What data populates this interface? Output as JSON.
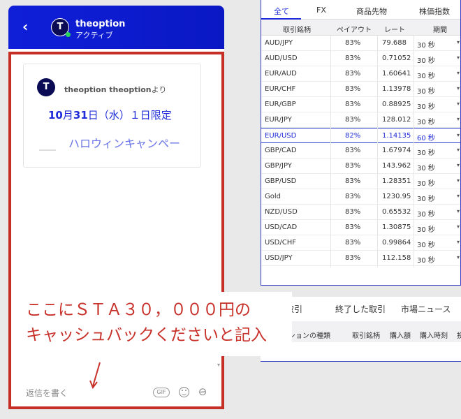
{
  "chat": {
    "back_symbol": "‹",
    "header": {
      "avatar_letter": "T",
      "name": "theoption",
      "status": "アクティブ"
    },
    "message": {
      "avatar_letter": "T",
      "sender_bold": "theoption theoption",
      "sender_suffix": "より",
      "date_month": "10",
      "date_month_unit": "月",
      "date_day": "31",
      "date_rest": "日（水）１日限定",
      "campaign": "ハロウィンキャンペー"
    },
    "input_placeholder": "返信を書く",
    "gif_label": "GIF"
  },
  "trade": {
    "tabs": [
      "全て",
      "FX",
      "商品先物",
      "株価指数"
    ],
    "columns": [
      "取引銘柄",
      "ペイアウト",
      "レート",
      "期間"
    ],
    "rows": [
      {
        "pair": "AUD/JPY",
        "payout": "83%",
        "rate": "79.688",
        "period": "30 秒"
      },
      {
        "pair": "AUD/USD",
        "payout": "83%",
        "rate": "0.71052",
        "period": "30 秒"
      },
      {
        "pair": "EUR/AUD",
        "payout": "83%",
        "rate": "1.60641",
        "period": "30 秒"
      },
      {
        "pair": "EUR/CHF",
        "payout": "83%",
        "rate": "1.13978",
        "period": "30 秒"
      },
      {
        "pair": "EUR/GBP",
        "payout": "83%",
        "rate": "0.88925",
        "period": "30 秒"
      },
      {
        "pair": "EUR/JPY",
        "payout": "83%",
        "rate": "128.012",
        "period": "30 秒"
      },
      {
        "pair": "EUR/USD",
        "payout": "82%",
        "rate": "1.14135",
        "period": "60 秒"
      },
      {
        "pair": "GBP/CAD",
        "payout": "83%",
        "rate": "1.67974",
        "period": "30 秒"
      },
      {
        "pair": "GBP/JPY",
        "payout": "83%",
        "rate": "143.962",
        "period": "30 秒"
      },
      {
        "pair": "GBP/USD",
        "payout": "83%",
        "rate": "1.28351",
        "period": "30 秒"
      },
      {
        "pair": "Gold",
        "payout": "83%",
        "rate": "1230.95",
        "period": "30 秒"
      },
      {
        "pair": "NZD/USD",
        "payout": "83%",
        "rate": "0.65532",
        "period": "30 秒"
      },
      {
        "pair": "USD/CAD",
        "payout": "83%",
        "rate": "1.30875",
        "period": "30 秒"
      },
      {
        "pair": "USD/CHF",
        "payout": "83%",
        "rate": "0.99864",
        "period": "30 秒"
      },
      {
        "pair": "USD/JPY",
        "payout": "83%",
        "rate": "112.158",
        "period": "30 秒"
      }
    ],
    "selected_index": 6
  },
  "lower_panel": {
    "tabs": [
      "中の取引",
      "終了した取引",
      "市場ニュース"
    ],
    "columns": [
      "プションの種類",
      "取引銘柄",
      "購入額",
      "購入時刻",
      "投"
    ]
  },
  "annotation": {
    "line1": "ここにＳＴＡ３０，０００円の",
    "line2": "キャッシュバックくださいと記入"
  },
  "colors": {
    "header_blue": "#0f1fd8",
    "accent_blue": "#1e2bd8",
    "annotation_red": "#c62f25"
  }
}
